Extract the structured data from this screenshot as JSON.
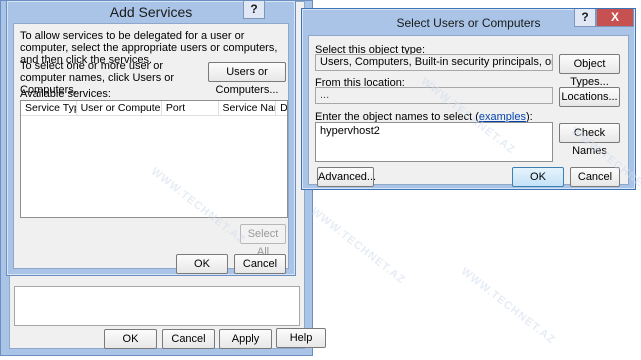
{
  "background_window": {
    "ok_label": "OK",
    "cancel_label": "Cancel",
    "apply_label": "Apply",
    "help_label": "Help"
  },
  "add_services": {
    "title": "Add Services",
    "help_btn": "?",
    "intro_text": "To allow services to be delegated for a user or computer, select the appropriate users or computers, and then click the services.",
    "select_text": "To select one or more user or computer names, click Users or Computers.",
    "users_or_computers_label": "Users or Computers...",
    "available_services_label": "Available services:",
    "columns": [
      "Service Type",
      "User or Computer",
      "Port",
      "Service Name",
      "D"
    ],
    "select_all_label": "Select All",
    "ok_label": "OK",
    "cancel_label": "Cancel"
  },
  "select_users": {
    "title": "Select Users or Computers",
    "help_btn": "?",
    "close_btn": "X",
    "object_type_label": "Select this object type:",
    "object_type_value": "Users, Computers, Built-in security principals, or Other objects",
    "object_types_label": "Object Types...",
    "location_label": "From this location:",
    "location_value": "...",
    "locations_label": "Locations...",
    "enter_names_prefix": "Enter the object names to select (",
    "examples_link": "examples",
    "enter_names_suffix": "):",
    "names_value": "hypervhost2",
    "check_names_label": "Check Names",
    "advanced_label": "Advanced...",
    "ok_label": "OK",
    "cancel_label": "Cancel"
  },
  "watermark": "WWW.TECHNET.AZ"
}
